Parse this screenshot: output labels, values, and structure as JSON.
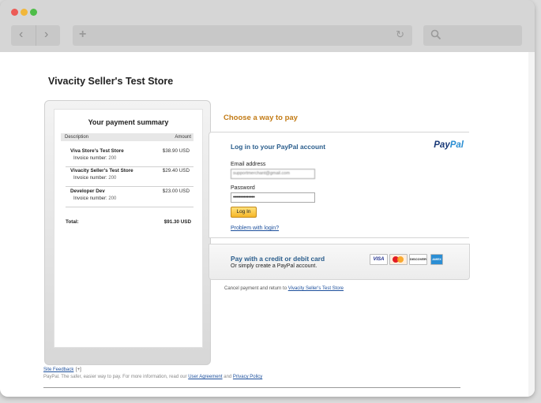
{
  "store": {
    "title": "Vivacity Seller's Test Store"
  },
  "summary": {
    "title": "Your payment summary",
    "col_description": "Description",
    "col_amount": "Amount",
    "items": [
      {
        "name": "Viva Store's Test Store",
        "invoice_label": "Invoice number:",
        "invoice_number": "200",
        "amount": "$38.90 USD"
      },
      {
        "name": "Vivacity Seller's Test Store",
        "invoice_label": "Invoice number:",
        "invoice_number": "200",
        "amount": "$29.40 USD"
      },
      {
        "name": "Developer Dev",
        "invoice_label": "Invoice number:",
        "invoice_number": "200",
        "amount": "$23.00 USD"
      }
    ],
    "total_label": "Total:",
    "total_amount": "$91.30 USD"
  },
  "pay": {
    "choose_title": "Choose a way to pay",
    "login_heading": "Log in to your PayPal account",
    "logo_pay": "Pay",
    "logo_pal": "Pal",
    "email_label": "Email address",
    "email_value": "supportmerchant@gmail.com",
    "password_label": "Password",
    "password_value": "••••••••••••••",
    "login_button": "Log In",
    "problem_link": "Problem with login?",
    "card_heading": "Pay with a credit or debit card",
    "card_sub": "Or simply create a PayPal account.",
    "cards": [
      "VISA",
      "MasterCard",
      "DISCOVER",
      "AMEX"
    ]
  },
  "cancel": {
    "text": "Cancel payment and return to",
    "link": "Vivacity Seller's Test Store"
  },
  "footer": {
    "site_feedback": "Site Feedback",
    "site_feedback_mark": "[+]",
    "tagline": "PayPal. The safer, easier way to pay. For more information, read our",
    "user_agreement": "User Agreement",
    "and": "and",
    "privacy_policy": "Privacy Policy"
  },
  "colors": {
    "accent_orange": "#c27a14",
    "heading_blue": "#2a5d8c",
    "link_blue": "#1c4f9c",
    "paypal_dark": "#1a3a78",
    "paypal_light": "#2a8ed2"
  }
}
